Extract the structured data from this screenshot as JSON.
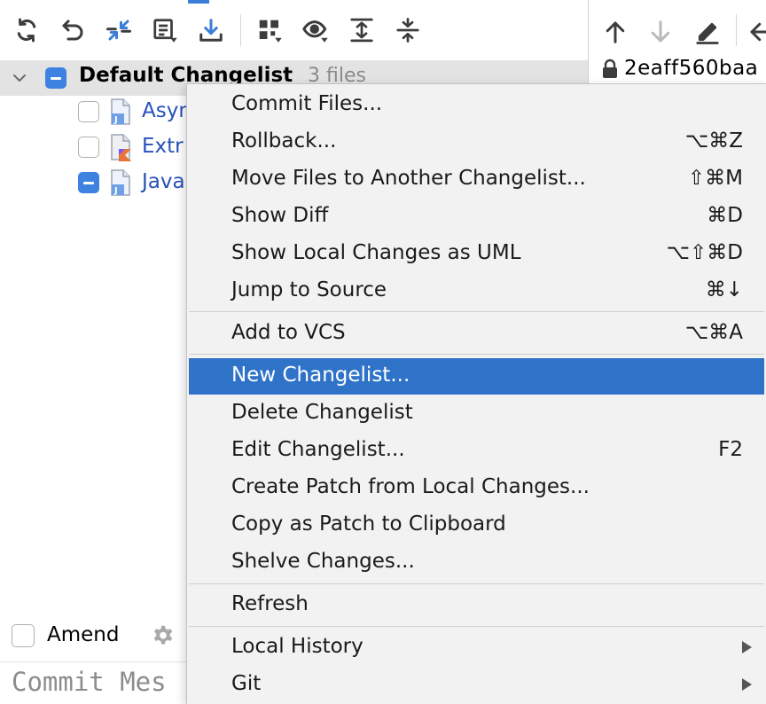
{
  "toolbar": {
    "buttons": [
      {
        "icon": "refresh-icon",
        "tooltip": "Refresh"
      },
      {
        "icon": "rollback-icon",
        "tooltip": "Rollback"
      },
      {
        "icon": "diff-arrows-icon",
        "tooltip": "Show Diff"
      },
      {
        "icon": "changelist-icon",
        "tooltip": "Changelist"
      },
      {
        "icon": "update-download-icon",
        "tooltip": "Update"
      },
      {
        "icon": "group-by-icon",
        "tooltip": "Group By"
      },
      {
        "icon": "eye-icon",
        "tooltip": "View Options"
      },
      {
        "icon": "expand-all-icon",
        "tooltip": "Expand All"
      },
      {
        "icon": "collapse-all-icon",
        "tooltip": "Collapse All"
      }
    ]
  },
  "changelist": {
    "title": "Default Changelist",
    "count": "3 files",
    "files": [
      {
        "name": "Asyn",
        "icon": "java-file-icon",
        "checked": false
      },
      {
        "name": "Extr",
        "icon": "kotlin-file-icon",
        "checked": false
      },
      {
        "name": "Java",
        "icon": "java-file-icon",
        "checked": "partial"
      }
    ]
  },
  "commit": {
    "amend_label": "Amend",
    "message_placeholder": "Commit Mes"
  },
  "right_panel": {
    "hash": "2eaff560baa",
    "buttons": [
      {
        "icon": "arrow-up-icon"
      },
      {
        "icon": "arrow-down-icon"
      },
      {
        "icon": "edit-pencil-icon"
      },
      {
        "icon": "arrow-left-icon"
      }
    ]
  },
  "menu": {
    "items": [
      {
        "label": "Commit Files...",
        "shortcut": ""
      },
      {
        "label": "Rollback...",
        "shortcut": "⌥⌘Z"
      },
      {
        "label": "Move Files to Another Changelist...",
        "shortcut": "⇧⌘M"
      },
      {
        "label": "Show Diff",
        "shortcut": "⌘D"
      },
      {
        "label": "Show Local Changes as UML",
        "shortcut": "⌥⇧⌘D"
      },
      {
        "label": "Jump to Source",
        "shortcut": "⌘↓"
      },
      {
        "label": "Add to VCS",
        "shortcut": "⌥⌘A"
      },
      {
        "label": "New Changelist...",
        "shortcut": "",
        "highlighted": true
      },
      {
        "label": "Delete Changelist",
        "shortcut": ""
      },
      {
        "label": "Edit Changelist...",
        "shortcut": "F2"
      },
      {
        "label": "Create Patch from Local Changes...",
        "shortcut": ""
      },
      {
        "label": "Copy as Patch to Clipboard",
        "shortcut": ""
      },
      {
        "label": "Shelve Changes...",
        "shortcut": ""
      },
      {
        "label": "Refresh",
        "shortcut": ""
      },
      {
        "label": "Local History",
        "shortcut": "",
        "submenu": true
      },
      {
        "label": "Git",
        "shortcut": "",
        "submenu": true
      }
    ]
  },
  "colors": {
    "accent": "#2f73c9",
    "checkbox_partial": "#3d82e0",
    "file_name": "#2750b8",
    "menu_bg": "#f2f2f2"
  }
}
